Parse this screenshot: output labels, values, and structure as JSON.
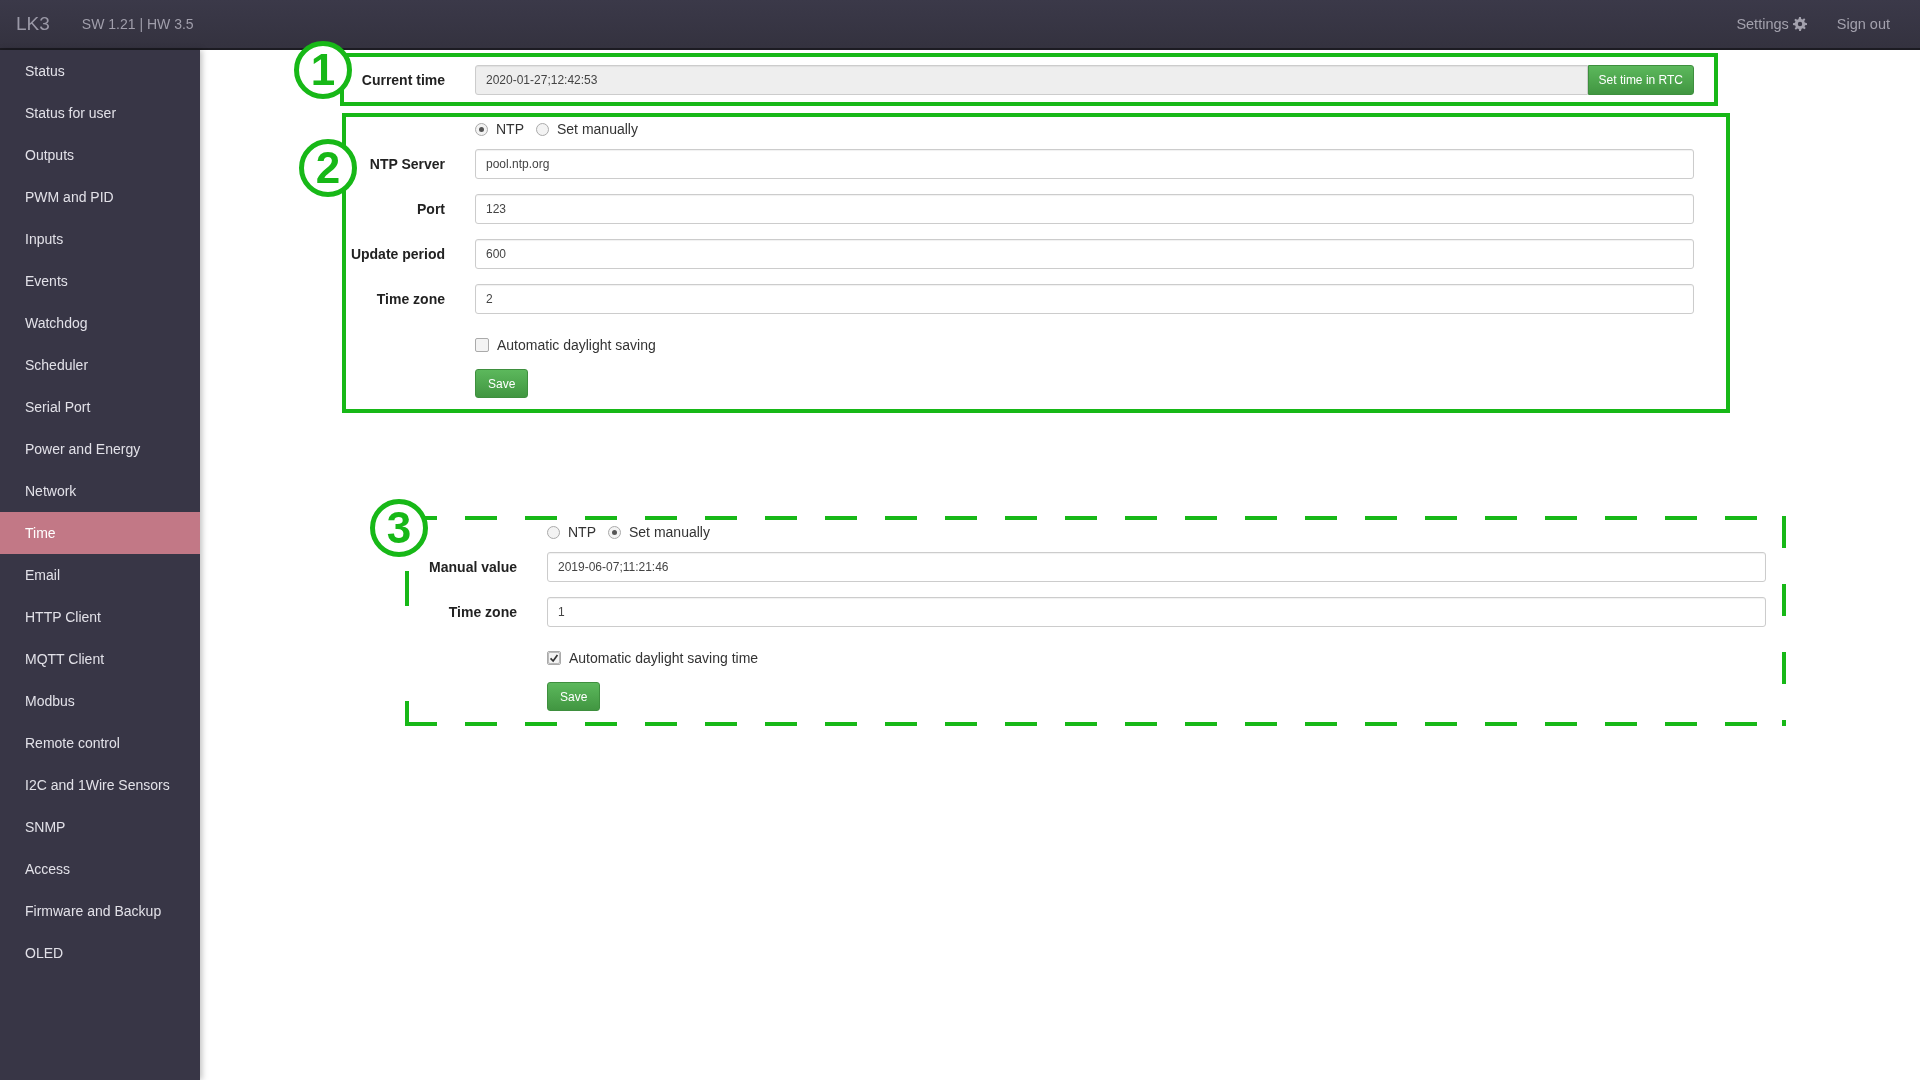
{
  "header": {
    "logo": "LK3",
    "version": "SW 1.21 | HW 3.5",
    "links": [
      {
        "label": "Settings",
        "kind": "settings"
      },
      {
        "label": "Sign out",
        "kind": "plain"
      }
    ]
  },
  "sidebar": {
    "items": [
      {
        "label": "Status",
        "selected": false
      },
      {
        "label": "Status for user",
        "selected": false
      },
      {
        "label": "Outputs",
        "selected": false
      },
      {
        "label": "PWM and PID",
        "selected": false
      },
      {
        "label": "Inputs",
        "selected": false
      },
      {
        "label": "Events",
        "selected": false
      },
      {
        "label": "Watchdog",
        "selected": false
      },
      {
        "label": "Scheduler",
        "selected": false
      },
      {
        "label": "Serial Port",
        "selected": false
      },
      {
        "label": "Power and Energy",
        "selected": false
      },
      {
        "label": "Network",
        "selected": false
      },
      {
        "label": "Time",
        "selected": true
      },
      {
        "label": "Email",
        "selected": false
      },
      {
        "label": "HTTP Client",
        "selected": false
      },
      {
        "label": "MQTT Client",
        "selected": false
      },
      {
        "label": "Modbus",
        "selected": false
      },
      {
        "label": "Remote control",
        "selected": false
      },
      {
        "label": "I2C and 1Wire Sensors",
        "selected": false
      },
      {
        "label": "SNMP",
        "selected": false
      },
      {
        "label": "Access",
        "selected": false
      },
      {
        "label": "Firmware and Backup",
        "selected": false
      },
      {
        "label": "OLED",
        "selected": false
      }
    ]
  },
  "sections": [
    {
      "marker": "1",
      "dashed": false,
      "rows": [
        {
          "kind": "field_button",
          "label": "Current time",
          "value": "2020-01-27;12:42:53",
          "readonly": true,
          "button": "Set time in RTC"
        }
      ]
    },
    {
      "marker": "2",
      "dashed": false,
      "rows": [
        {
          "kind": "radios",
          "options": [
            {
              "label": "NTP",
              "selected": true
            },
            {
              "label": "Set manually",
              "selected": false
            }
          ]
        },
        {
          "kind": "field",
          "label": "NTP Server",
          "value": "pool.ntp.org",
          "readonly": false
        },
        {
          "kind": "field",
          "label": "Port",
          "value": "123",
          "readonly": false
        },
        {
          "kind": "field",
          "label": "Update period",
          "value": "600",
          "readonly": false
        },
        {
          "kind": "field",
          "label": "Time zone",
          "value": "2",
          "readonly": false
        },
        {
          "kind": "checkbox",
          "label": "Automatic daylight saving",
          "checked": false
        },
        {
          "kind": "button",
          "label": "Save"
        }
      ]
    },
    {
      "marker": "3",
      "dashed": true,
      "rows": [
        {
          "kind": "radios",
          "options": [
            {
              "label": "NTP",
              "selected": false
            },
            {
              "label": "Set manually",
              "selected": true
            }
          ]
        },
        {
          "kind": "field",
          "label": "Manual value",
          "value": "2019-06-07;11:21:46",
          "readonly": false
        },
        {
          "kind": "field",
          "label": "Time zone",
          "value": "1",
          "readonly": false
        },
        {
          "kind": "checkbox",
          "label": "Automatic daylight saving time",
          "checked": true
        },
        {
          "kind": "button",
          "label": "Save"
        }
      ]
    }
  ]
}
